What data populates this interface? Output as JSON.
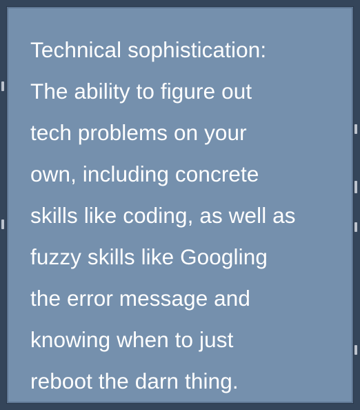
{
  "tooltip": {
    "lines": [
      "Technical sophistication:",
      "The ability to figure out",
      "tech problems on your",
      "own, including concrete",
      "skills like coding, as well as",
      "fuzzy skills like Googling",
      "the error message and",
      "knowing when to just",
      "reboot the darn thing."
    ]
  },
  "colors": {
    "card_background": "#7590ad",
    "card_border": "#5d7490",
    "page_background": "#34455a",
    "text": "#ffffff"
  }
}
